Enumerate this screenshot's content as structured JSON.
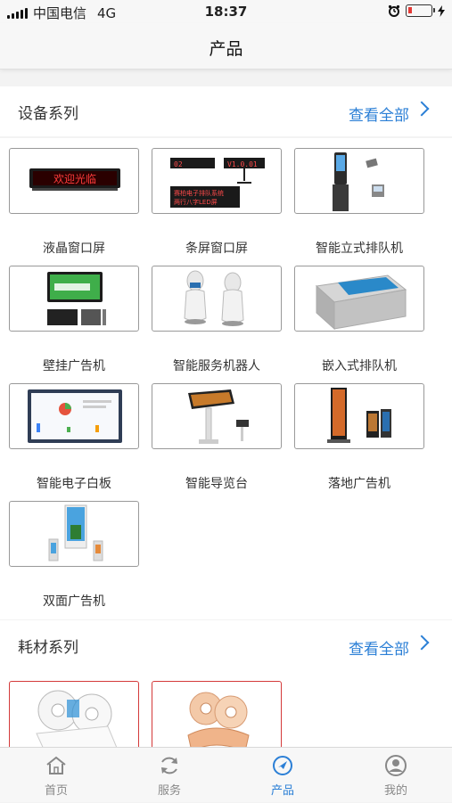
{
  "status_bar": {
    "carrier": "中国电信",
    "network": "4G",
    "time": "18:37"
  },
  "navbar": {
    "title": "产品"
  },
  "sections": [
    {
      "label": "设备系列",
      "more": "查看全部",
      "items": [
        {
          "name": "液晶窗口屏",
          "image": "led-sign-image"
        },
        {
          "name": "条屏窗口屏",
          "image": "strip-screen-image"
        },
        {
          "name": "智能立式排队机",
          "image": "kiosk-image"
        },
        {
          "name": "壁挂广告机",
          "image": "wall-display-image"
        },
        {
          "name": "智能服务机器人",
          "image": "robot-image"
        },
        {
          "name": "嵌入式排队机",
          "image": "embedded-kiosk-image"
        },
        {
          "name": "智能电子白板",
          "image": "whiteboard-image"
        },
        {
          "name": "智能导览台",
          "image": "guide-table-image"
        },
        {
          "name": "落地广告机",
          "image": "floor-display-image"
        },
        {
          "name": "双面广告机",
          "image": "double-display-image"
        }
      ]
    },
    {
      "label": "耗材系列",
      "more": "查看全部",
      "items": [
        {
          "name": "",
          "image": "thermal-paper-roll-image"
        },
        {
          "name": "",
          "image": "orange-paper-roll-image"
        }
      ]
    }
  ],
  "led_text": "欢迎光临",
  "strip_text": {
    "a": "02",
    "b": "V1.0.01",
    "c": "赛柏电子排队系统",
    "d": "两行八字LED屏"
  },
  "tabbar": {
    "items": [
      {
        "label": "首页",
        "icon": "home-icon",
        "active": false
      },
      {
        "label": "服务",
        "icon": "refresh-icon",
        "active": false
      },
      {
        "label": "产品",
        "icon": "compass-icon",
        "active": true
      },
      {
        "label": "我的",
        "icon": "user-icon",
        "active": false
      }
    ]
  },
  "colors": {
    "accent": "#2b7fd6",
    "led_red": "#ff3b3b"
  }
}
